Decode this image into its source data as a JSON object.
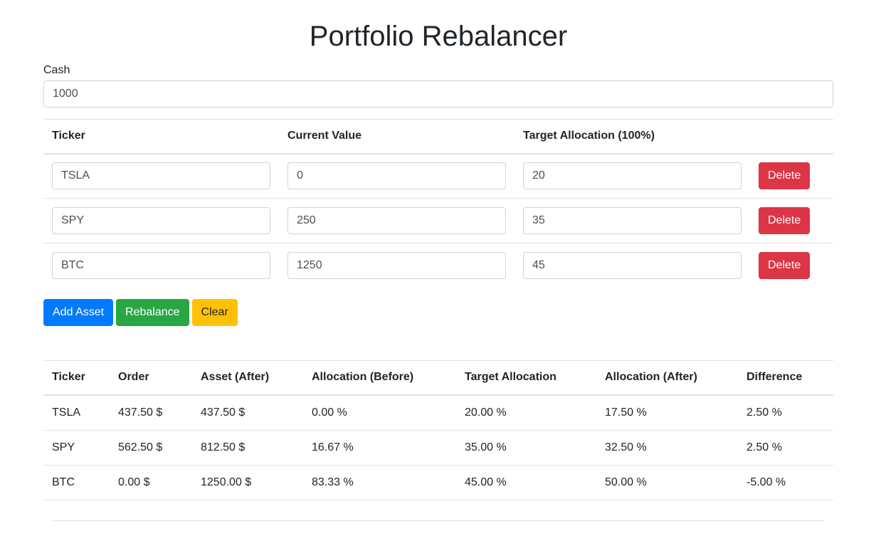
{
  "page": {
    "title": "Portfolio Rebalancer"
  },
  "cash": {
    "label": "Cash",
    "value": "1000"
  },
  "assets_table": {
    "headers": [
      "Ticker",
      "Current Value",
      "Target Allocation (100%)"
    ],
    "rows": [
      {
        "ticker": "TSLA",
        "current_value": "0",
        "target": "20",
        "delete_label": "Delete"
      },
      {
        "ticker": "SPY",
        "current_value": "250",
        "target": "35",
        "delete_label": "Delete"
      },
      {
        "ticker": "BTC",
        "current_value": "1250",
        "target": "45",
        "delete_label": "Delete"
      }
    ]
  },
  "actions": {
    "add_label": "Add Asset",
    "rebalance_label": "Rebalance",
    "clear_label": "Clear"
  },
  "results_table": {
    "headers": [
      "Ticker",
      "Order",
      "Asset (After)",
      "Allocation (Before)",
      "Target Allocation",
      "Allocation (After)",
      "Difference"
    ],
    "rows": [
      [
        "TSLA",
        "437.50 $",
        "437.50 $",
        "0.00 %",
        "20.00 %",
        "17.50 %",
        "2.50 %"
      ],
      [
        "SPY",
        "562.50 $",
        "812.50 $",
        "16.67 %",
        "35.00 %",
        "32.50 %",
        "2.50 %"
      ],
      [
        "BTC",
        "0.00 $",
        "1250.00 $",
        "83.33 %",
        "45.00 %",
        "50.00 %",
        "-5.00 %"
      ]
    ]
  },
  "colors": {
    "primary": "#007bff",
    "success": "#28a745",
    "warning": "#ffc107",
    "danger": "#dc3545"
  }
}
